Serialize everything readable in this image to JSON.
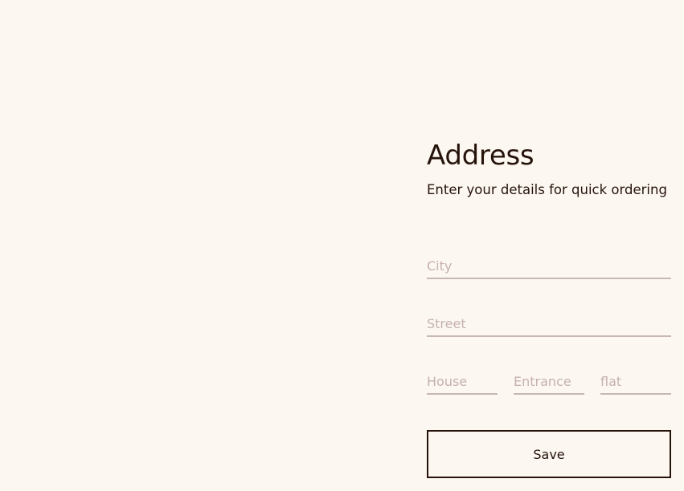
{
  "address_form": {
    "title": "Address",
    "subtitle": "Enter your details for quick ordering",
    "city": {
      "value": "",
      "placeholder": "City"
    },
    "street": {
      "value": "",
      "placeholder": "Street"
    },
    "house": {
      "value": "",
      "placeholder": "House"
    },
    "entrance": {
      "value": "",
      "placeholder": "Entrance"
    },
    "flat": {
      "value": "",
      "placeholder": "flat"
    },
    "save_label": "Save"
  },
  "colors": {
    "background": "#fcf7f1",
    "text": "#26140c",
    "field_underline": "#c9b6b6",
    "placeholder": "#c6b1b2"
  }
}
